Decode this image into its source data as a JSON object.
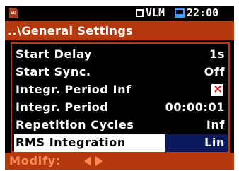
{
  "status": {
    "sd_icon": "sd-card-icon",
    "sd_label": "SD",
    "mode": "VLM",
    "time": "22:00"
  },
  "title": "..\\General Settings",
  "rows": [
    {
      "label": "Start Delay",
      "value": "1s"
    },
    {
      "label": "Start Sync.",
      "value": "Off"
    },
    {
      "label": "Integr. Period Inf",
      "value": "",
      "checkbox": "checked",
      "checkbox_glyph": "×"
    },
    {
      "label": "Integr. Period",
      "value": "00:00:01"
    },
    {
      "label": "Repetition Cycles",
      "value": "Inf"
    },
    {
      "label": "RMS Integration",
      "value": "Lin",
      "selected": true
    }
  ],
  "hint": {
    "label": "Modify:",
    "icons": [
      "arrow-left-icon",
      "arrow-right-icon"
    ]
  },
  "colors": {
    "title_bar": "#b5390f",
    "hint_text": "#ff8a55",
    "selected_value_bg": "#0a1a5c",
    "battery": "#3aa0ff",
    "checkbox_mark": "#e01818"
  }
}
